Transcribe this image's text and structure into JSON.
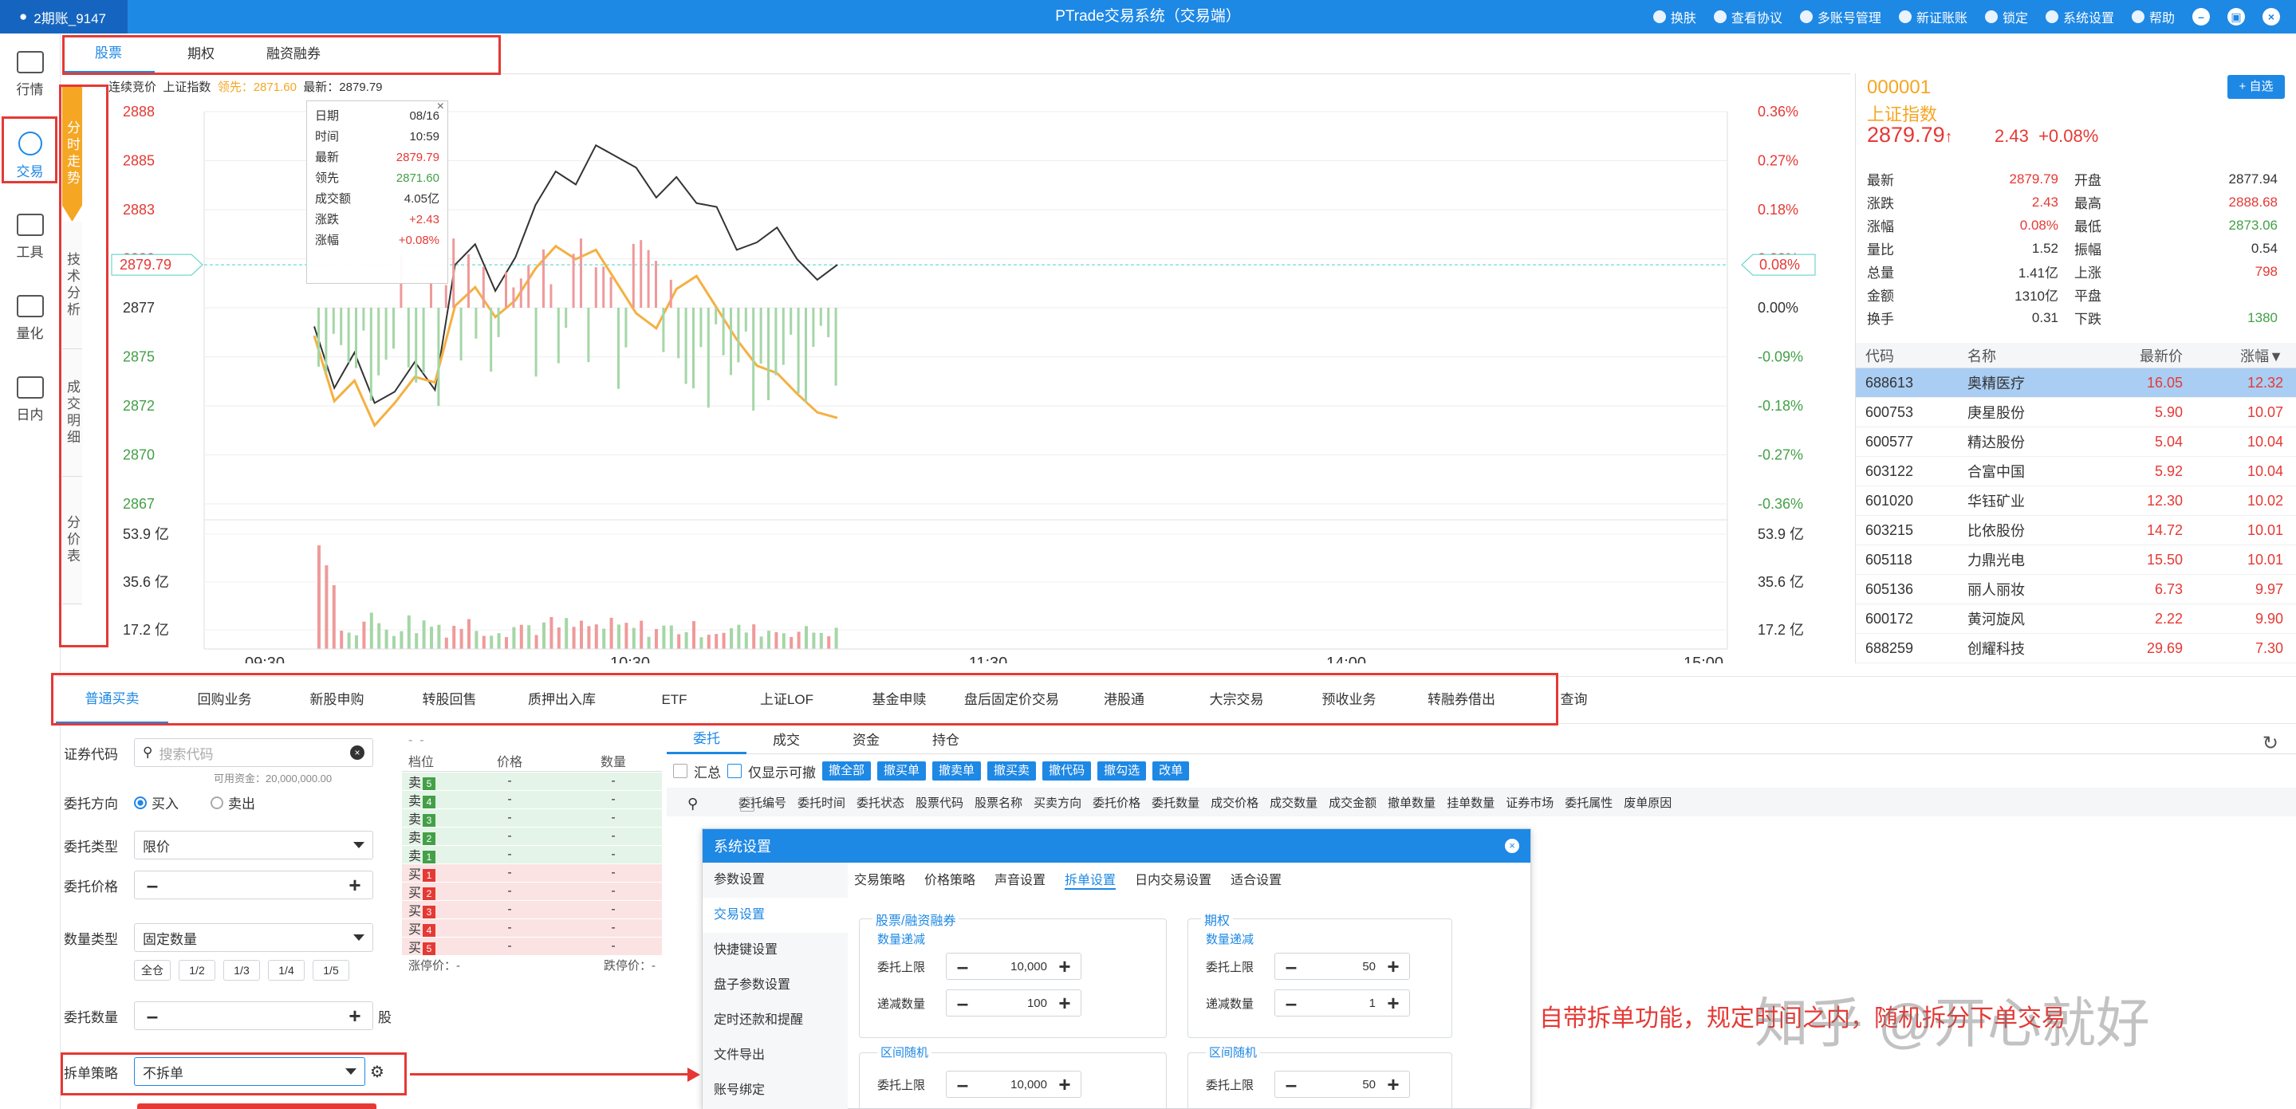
{
  "titlebar": {
    "user": "2期账_9147",
    "title": "PTrade交易系统（交易端）",
    "actions": [
      "换肤",
      "查看协议",
      "多账号管理",
      "新证账账",
      "锁定",
      "系统设置",
      "帮助"
    ]
  },
  "leftnav": [
    {
      "label": "行情",
      "icon": "chart-icon"
    },
    {
      "label": "交易",
      "icon": "trade-icon"
    },
    {
      "label": "工具",
      "icon": "toolbox-icon"
    },
    {
      "label": "量化",
      "icon": "quant-icon"
    },
    {
      "label": "日内",
      "icon": "intraday-icon"
    }
  ],
  "toptabs": [
    "股票",
    "期权",
    "融资融券"
  ],
  "vtabs": [
    "分时走势",
    "技术分析",
    "成交明细",
    "分价表"
  ],
  "chart_info": {
    "prefix": "连续竞价",
    "index": "上证指数",
    "lead": "领先：2871.60",
    "latest": "最新：2879.79"
  },
  "chart_data": {
    "type": "line",
    "title": "",
    "price_ticks": [
      "2888",
      "2885",
      "2883",
      "2880",
      "2877",
      "2875",
      "2872",
      "2870",
      "2867"
    ],
    "current_price_label": "2879.79",
    "pct_ticks": [
      "0.36%",
      "0.27%",
      "0.18%",
      "0.09%",
      "0.00%",
      "-0.09%",
      "-0.18%",
      "-0.27%",
      "-0.36%"
    ],
    "current_pct_label": "0.08%",
    "volume_ticks": [
      "53.9 亿",
      "35.6 亿",
      "17.2 亿"
    ],
    "x_ticks": [
      "09:30",
      "10:30",
      "11:30",
      "14:00",
      "15:00"
    ],
    "ylim": [
      2867,
      2888
    ],
    "series": [
      {
        "values": [
          2876.5,
          2873.2,
          2875.1,
          2872.4,
          2873.0,
          2874.6,
          2873.1,
          2879.8,
          2880.9,
          2878.4,
          2880.2,
          2883.0,
          2884.8,
          2884.1,
          2886.2,
          2885.6,
          2885.0,
          2883.4,
          2884.5,
          2883.1,
          2882.9,
          2880.6,
          2881.0,
          2881.8,
          2880.1,
          2879.0,
          2879.8
        ],
        "color": "#333333"
      },
      {
        "values": [
          2876.0,
          2872.5,
          2873.6,
          2871.2,
          2872.4,
          2873.8,
          2873.5,
          2877.6,
          2878.6,
          2877.0,
          2877.9,
          2879.6,
          2880.8,
          2880.1,
          2880.6,
          2878.9,
          2877.2,
          2876.4,
          2878.5,
          2879.2,
          2877.5,
          2875.8,
          2874.4,
          2874.0,
          2872.9,
          2871.9,
          2871.6
        ],
        "color": "#f5b041"
      }
    ]
  },
  "tooltip": [
    {
      "k": "日期",
      "v": "08/16"
    },
    {
      "k": "时间",
      "v": "10:59"
    },
    {
      "k": "最新",
      "v": "2879.79"
    },
    {
      "k": "领先",
      "v": "2871.60"
    },
    {
      "k": "成交额",
      "v": "4.05亿"
    },
    {
      "k": "涨跌",
      "v": "+2.43"
    },
    {
      "k": "涨幅",
      "v": "+0.08%"
    }
  ],
  "quote": {
    "code": "000001",
    "name": "上证指数",
    "price": "2879.79",
    "change": "2.43",
    "change_pct": "+0.08%",
    "add_button": "+ 自选",
    "stats": [
      {
        "k1": "最新",
        "v1": "2879.79",
        "k2": "开盘",
        "v2": "2877.94"
      },
      {
        "k1": "涨跌",
        "v1": "2.43",
        "k2": "最高",
        "v2": "2888.68"
      },
      {
        "k1": "涨幅",
        "v1": "0.08%",
        "k2": "最低",
        "v2": "2873.06"
      },
      {
        "k1": "量比",
        "v1": "1.52",
        "k2": "振幅",
        "v2": "0.54"
      },
      {
        "k1": "总量",
        "v1": "1.41亿",
        "k2": "上涨",
        "v2": "798"
      },
      {
        "k1": "金额",
        "v1": "1310亿",
        "k2": "平盘",
        "v2": ""
      },
      {
        "k1": "换手",
        "v1": "0.31",
        "k2": "下跌",
        "v2": "1380"
      }
    ],
    "rank_headers": [
      "代码",
      "名称",
      "最新价",
      "涨幅"
    ],
    "rank": [
      [
        "688613",
        "奥精医疗",
        "16.05",
        "12.32"
      ],
      [
        "600753",
        "庚星股份",
        "5.90",
        "10.07"
      ],
      [
        "600577",
        "精达股份",
        "5.04",
        "10.04"
      ],
      [
        "603122",
        "合富中国",
        "5.92",
        "10.04"
      ],
      [
        "601020",
        "华钰矿业",
        "12.30",
        "10.02"
      ],
      [
        "603215",
        "比依股份",
        "14.72",
        "10.01"
      ],
      [
        "605118",
        "力鼎光电",
        "15.50",
        "10.01"
      ],
      [
        "605136",
        "丽人丽妆",
        "6.73",
        "9.97"
      ],
      [
        "600172",
        "黄河旋风",
        "2.22",
        "9.90"
      ],
      [
        "688259",
        "创耀科技",
        "29.69",
        "7.30"
      ]
    ]
  },
  "funcbar": [
    "普通买卖",
    "回购业务",
    "新股申购",
    "转股回售",
    "质押出入库",
    "ETF",
    "上证LOF",
    "基金申赎",
    "盘后固定价交易",
    "港股通",
    "大宗交易",
    "预收业务",
    "转融券借出",
    "查询"
  ],
  "orderform": {
    "code_label": "证券代码",
    "code_placeholder": "搜索代码",
    "available": "可用资金：20,000,000.00",
    "direction_label": "委托方向",
    "buy": "买入",
    "sell": "卖出",
    "type_label": "委托类型",
    "type_value": "限价",
    "price_label": "委托价格",
    "qty_type_label": "数量类型",
    "qty_type_value": "固定数量",
    "fractions": [
      "全仓",
      "1/2",
      "1/3",
      "1/4",
      "1/5"
    ],
    "qty_label": "委托数量",
    "qty_unit": "股",
    "split_label": "拆单策略",
    "split_value": "不拆单"
  },
  "book": {
    "headers": [
      "档位",
      "价格",
      "数量"
    ],
    "asks": [
      {
        "side": "卖",
        "lv": "5"
      },
      {
        "side": "卖",
        "lv": "4"
      },
      {
        "side": "卖",
        "lv": "3"
      },
      {
        "side": "卖",
        "lv": "2"
      },
      {
        "side": "卖",
        "lv": "1"
      }
    ],
    "bids": [
      {
        "side": "买",
        "lv": "1"
      },
      {
        "side": "买",
        "lv": "2"
      },
      {
        "side": "买",
        "lv": "3"
      },
      {
        "side": "买",
        "lv": "4"
      },
      {
        "side": "买",
        "lv": "5"
      }
    ],
    "placeholder": "-",
    "footer_left": "涨停价：-",
    "footer_right": "跌停价：-"
  },
  "orders": {
    "tabs": [
      "委托",
      "成交",
      "资金",
      "持仓"
    ],
    "summary": "汇总",
    "only_cancellable": "仅显示可撤",
    "buttons": [
      "撤全部",
      "撤买单",
      "撤卖单",
      "撤买卖",
      "撤代码",
      "撤勾选",
      "改单"
    ],
    "headers": [
      "委托编号",
      "委托时间",
      "委托状态",
      "股票代码",
      "股票名称",
      "买卖方向",
      "委托价格",
      "委托数量",
      "成交价格",
      "成交数量",
      "成交金额",
      "撤单数量",
      "挂单数量",
      "证券市场",
      "委托属性",
      "废单原因"
    ]
  },
  "dialog": {
    "title": "系统设置",
    "side": [
      "参数设置",
      "交易设置",
      "快捷键设置",
      "盘子参数设置",
      "定时还款和提醒",
      "文件导出",
      "账号绑定"
    ],
    "tabs": [
      "交易策略",
      "价格策略",
      "声音设置",
      "拆单设置",
      "日内交易设置",
      "适合设置"
    ],
    "group_stock": "股票/融资融券",
    "group_option": "期权",
    "sub_qty": "数量递减",
    "sub_range": "区间随机",
    "upper": "委托上限",
    "decrement": "递减数量",
    "stock_upper": "10,000",
    "stock_dec": "100",
    "stock_range_upper": "10,000",
    "opt_upper": "50",
    "opt_dec": "1",
    "opt_range_upper": "50"
  },
  "annotation": "自带拆单功能，规定时间之内，随机拆分下单交易",
  "watermark": "知乎 @开心就好",
  "colors": {
    "accent": "#1e88e5",
    "up": "#e53935",
    "down": "#43a047",
    "lead": "#f5a623"
  }
}
